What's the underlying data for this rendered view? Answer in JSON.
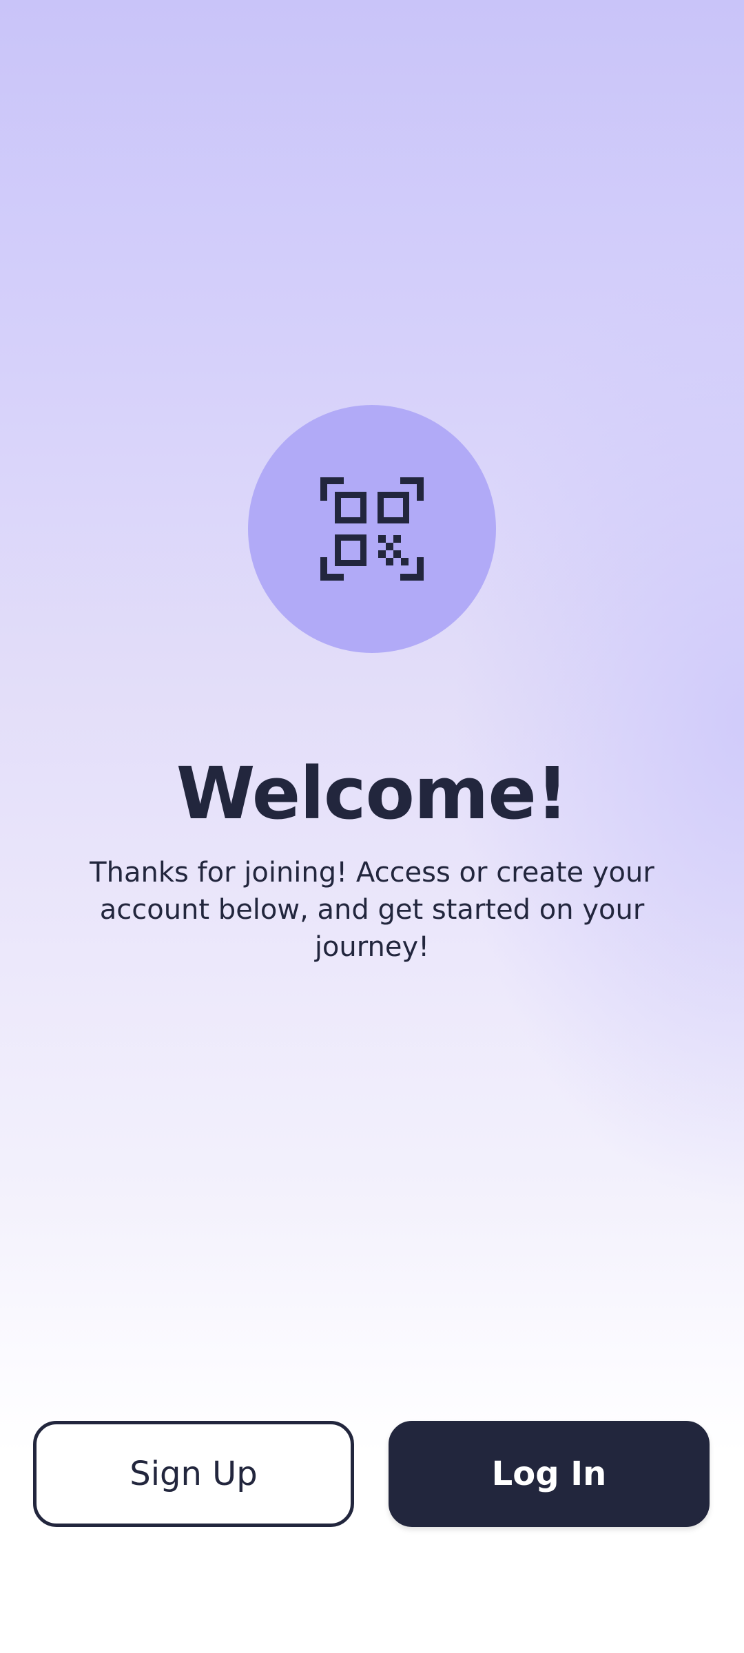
{
  "colors": {
    "icon_circle": "#b1aaf7",
    "text_dark": "#22263d",
    "button_dark": "#22263d",
    "button_light": "#ffffff",
    "login_text": "#ffffff"
  },
  "logo": {
    "icon": "qr-code-scan-icon"
  },
  "welcome": {
    "title": "Welcome!",
    "message": "Thanks for joining! Access or create your account below, and get started on your journey!"
  },
  "actions": {
    "signup_label": "Sign Up",
    "login_label": "Log In"
  }
}
